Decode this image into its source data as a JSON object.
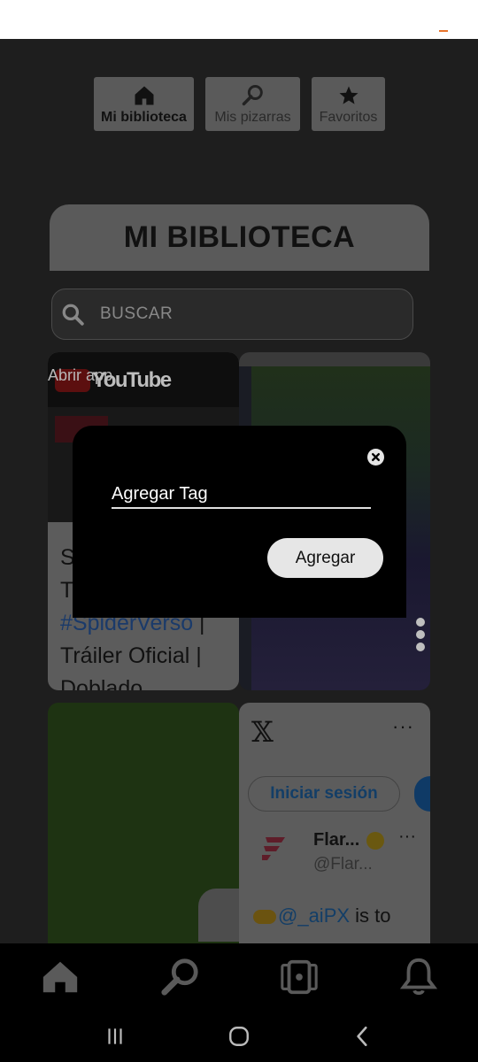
{
  "top_tabs": [
    {
      "label": "Mi biblioteca",
      "icon": "home-icon",
      "active": true
    },
    {
      "label": "Mis pizarras",
      "icon": "search-icon",
      "active": false
    },
    {
      "label": "Favoritos",
      "icon": "star-icon",
      "active": false
    }
  ],
  "page_title": "MI BIBLIOTECA",
  "search": {
    "placeholder": "BUSCAR",
    "icon": "search-icon"
  },
  "cards": {
    "youtube": {
      "open_label": "Abrir app",
      "brand": "YouTube",
      "title_start": "S",
      "title_line2": "T",
      "hashtag": "#SpiderVerso",
      "sep": " |",
      "line4": "Tráiler Oficial |",
      "line5": "Doblado"
    },
    "x": {
      "logo": "𝕏",
      "more": "···",
      "login_label": "Iniciar sesión",
      "account_name": "Flar...",
      "account_handle": "@Flar...",
      "tweet_mention": "@_aiPX",
      "tweet_text": " is to"
    }
  },
  "dialog": {
    "placeholder": "Agregar Tag",
    "submit_label": "Agregar",
    "close_icon": "close-icon"
  },
  "bottom_nav": [
    "home-icon",
    "search-icon",
    "phone-frame-icon",
    "bell-icon"
  ],
  "system_nav": [
    "recents-icon",
    "home-circle-icon",
    "back-icon"
  ],
  "colors": {
    "accent": "#e8742c",
    "overlay_bg": "#1e1e1e",
    "dialog_bg": "#000000"
  }
}
